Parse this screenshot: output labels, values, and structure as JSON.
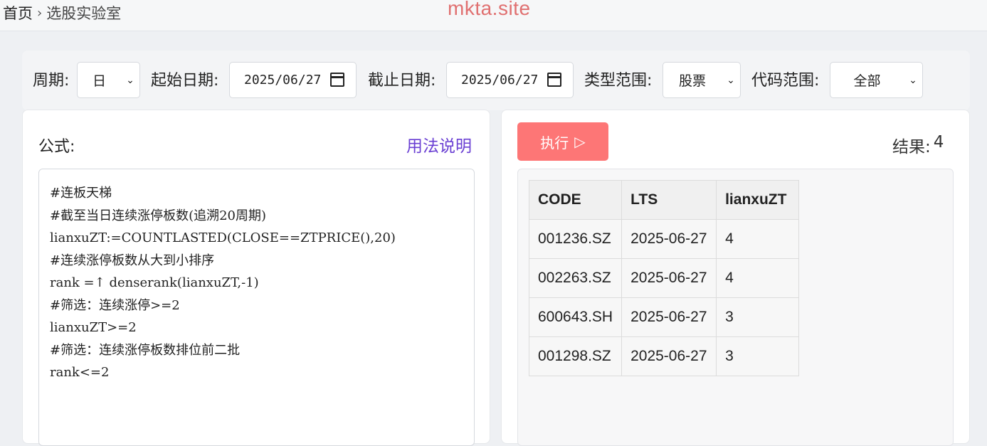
{
  "breadcrumb": {
    "home": "首页",
    "separator": "›",
    "current": "选股实验室"
  },
  "watermark": "mkta.site",
  "toolbar": {
    "period_label": "周期:",
    "period_value": "日",
    "start_label": "起始日期:",
    "start_value": "2025/06/27",
    "end_label": "截止日期:",
    "end_value": "2025/06/27",
    "type_label": "类型范围:",
    "type_value": "股票",
    "code_label": "代码范围:",
    "code_value": "全部"
  },
  "formula": {
    "label": "公式:",
    "help_link": "用法说明",
    "lines": [
      "#连板天梯",
      "#截至当日连续涨停板数(追溯20周期)",
      "lianxuZT:=COUNTLASTED(CLOSE==ZTPRICE(),20)",
      "#连续涨停板数从大到小排序",
      "rank =↑ denserank(lianxuZT,-1)",
      "#筛选：连续涨停>=2",
      "lianxuZT>=2",
      "#筛选：连续涨停板数排位前二批",
      "rank<=2"
    ]
  },
  "run": {
    "label": "执行",
    "icon": "▷"
  },
  "result": {
    "label": "结果:",
    "count": "4"
  },
  "table": {
    "headers": [
      "CODE",
      "LTS",
      "lianxuZT"
    ],
    "rows": [
      [
        "001236.SZ",
        "2025-06-27",
        "4"
      ],
      [
        "002263.SZ",
        "2025-06-27",
        "4"
      ],
      [
        "600643.SH",
        "2025-06-27",
        "3"
      ],
      [
        "001298.SZ",
        "2025-06-27",
        "3"
      ]
    ]
  }
}
